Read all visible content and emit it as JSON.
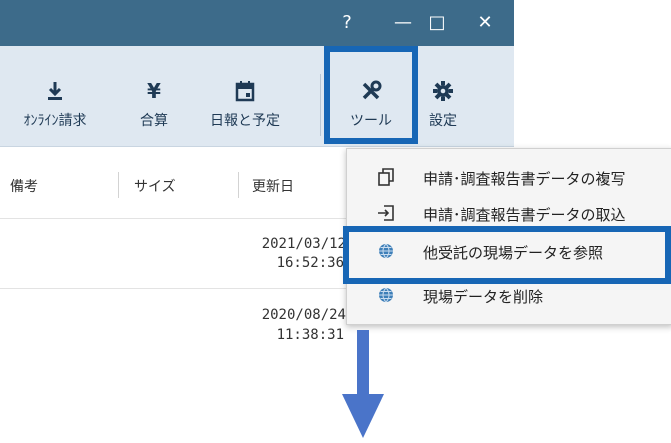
{
  "window": {
    "controls": {
      "help": "?",
      "minimize": "—",
      "maximize": "□",
      "close": "✕"
    }
  },
  "ribbon": {
    "online_billing": "ｵﾝﾗｲﾝ請求",
    "total": "合算",
    "daily_report": "日報と予定",
    "tools": "ツール",
    "settings": "設定",
    "yen_symbol": "¥"
  },
  "table": {
    "columns": [
      "備考",
      "サイズ",
      "更新日"
    ],
    "rows": [
      {
        "date": "2021/03/12",
        "time": "16:52:36"
      },
      {
        "date": "2020/08/24",
        "time": "11:38:31"
      }
    ]
  },
  "tools_menu": {
    "items": [
      {
        "label": "申請･調査報告書データの複写",
        "icon": "copy-icon"
      },
      {
        "label": "申請･調査報告書データの取込",
        "icon": "import-icon"
      },
      {
        "label": "他受託の現場データを参照",
        "icon": "globe-icon"
      },
      {
        "label": "現場データを削除",
        "icon": "globe-icon"
      }
    ]
  },
  "colors": {
    "titlebar": "#3d6b8a",
    "ribbon": "#dfe8f1",
    "highlight": "#1766b5",
    "arrow": "#4a74c9"
  }
}
